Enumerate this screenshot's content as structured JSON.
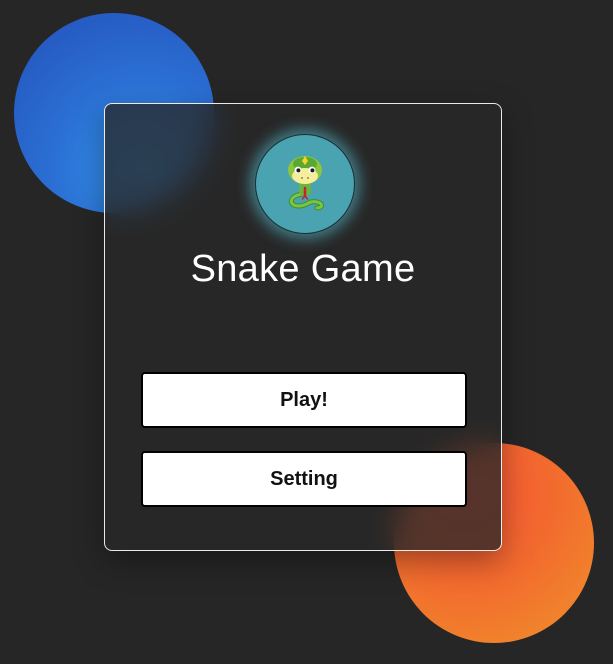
{
  "menu": {
    "logo_icon": "snake-icon",
    "title": "Snake Game",
    "buttons": {
      "play_label": "Play!",
      "setting_label": "Setting"
    }
  },
  "decor": {
    "blue_blob_color": "#2b6fd4",
    "orange_blob_color": "#f26a2e",
    "background_color": "#262626"
  }
}
